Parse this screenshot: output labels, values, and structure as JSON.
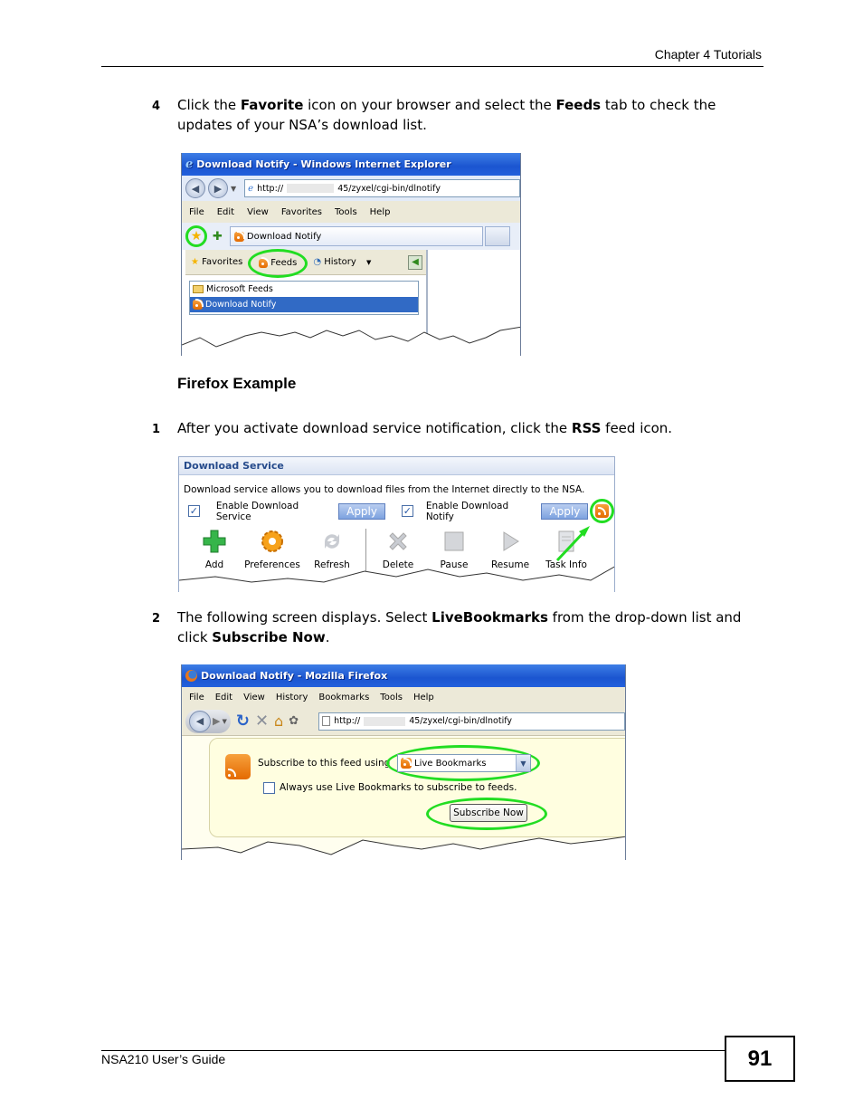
{
  "header": {
    "chapter": "Chapter 4 Tutorials"
  },
  "steps": {
    "ie_step": {
      "num": "4",
      "t1": "Click the ",
      "b1": "Favorite",
      "t2": " icon on your browser and select the ",
      "b2": "Feeds",
      "t3": " tab to check the updates of your NSA’s download list."
    },
    "ff_title": "Firefox Example",
    "ff_step1": {
      "num": "1",
      "t1": "After you activate download service notification, click the ",
      "b1": "RSS",
      "t2": " feed icon."
    },
    "ff_step2": {
      "num": "2",
      "t1": "The following screen displays. Select ",
      "b1": "LiveBookmarks",
      "t2": " from the drop-down list and click ",
      "b2": "Subscribe Now",
      "t3": "."
    }
  },
  "ie_window": {
    "title": "Download Notify - Windows Internet Explorer",
    "address": "http://",
    "address_suffix": "45/zyxel/cgi-bin/dlnotify",
    "menu": [
      "File",
      "Edit",
      "View",
      "Favorites",
      "Tools",
      "Help"
    ],
    "tab": "Download Notify",
    "panel_tabs": {
      "favorites": "Favorites",
      "feeds": "Feeds",
      "history": "History"
    },
    "feeds": [
      "Microsoft Feeds",
      "Download Notify"
    ]
  },
  "download_service": {
    "title": "Download Service",
    "description": "Download service allows you to download files from the Internet directly to the NSA.",
    "enable_service": "Enable Download Service",
    "enable_notify": "Enable Download Notify",
    "apply": "Apply",
    "toolbar": [
      "Add",
      "Preferences",
      "Refresh",
      "Delete",
      "Pause",
      "Resume",
      "Task Info"
    ]
  },
  "ff_window": {
    "title": "Download Notify - Mozilla Firefox",
    "menu": [
      "File",
      "Edit",
      "View",
      "History",
      "Bookmarks",
      "Tools",
      "Help"
    ],
    "address": "http://",
    "address_suffix": "45/zyxel/cgi-bin/dlnotify",
    "subscribe_label": "Subscribe to this feed using",
    "select_value": "Live Bookmarks",
    "always_label": "Always use Live Bookmarks to subscribe to feeds.",
    "subscribe_button": "Subscribe Now"
  },
  "footer": {
    "guide": "NSA210 User’s Guide",
    "page": "91"
  },
  "colors": {
    "highlight": "#22dd22",
    "xp_blue": "#1b55d0",
    "selection": "#316ac5"
  }
}
